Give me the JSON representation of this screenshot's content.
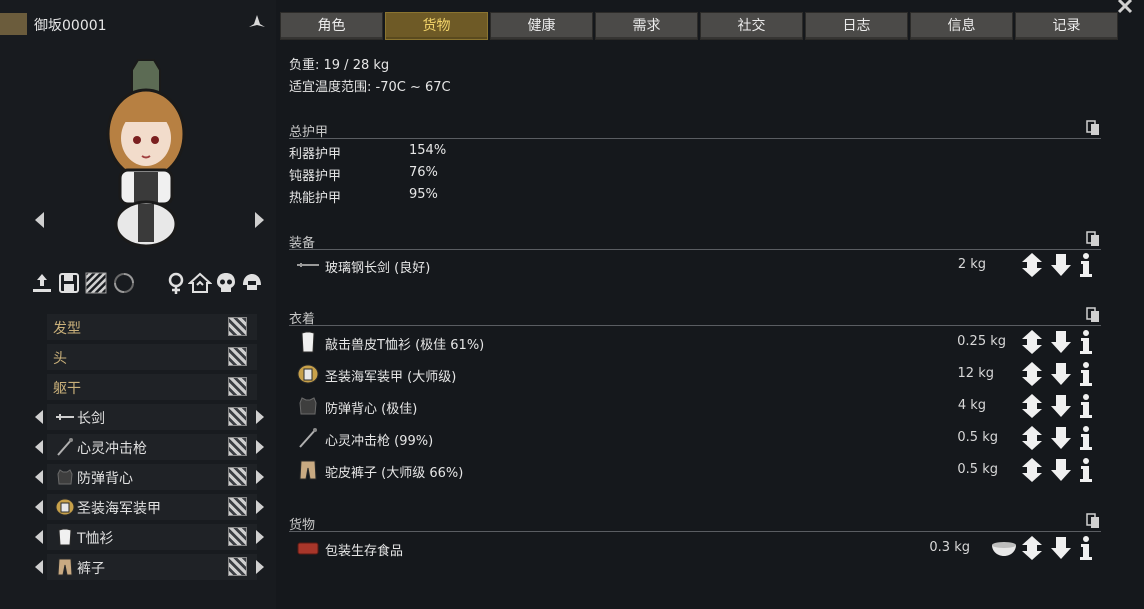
{
  "pawn": {
    "name": "御坂00001"
  },
  "tabs": [
    {
      "label": "角色"
    },
    {
      "label": "货物"
    },
    {
      "label": "健康"
    },
    {
      "label": "需求"
    },
    {
      "label": "社交"
    },
    {
      "label": "日志"
    },
    {
      "label": "信息"
    },
    {
      "label": "记录"
    }
  ],
  "active_tab_index": 1,
  "gear": {
    "mass_line": "负重: 19 / 28 kg",
    "temp_line": "适宜温度范围: -70C ~ 67C",
    "armor": {
      "title": "总护甲",
      "rows": [
        {
          "label": "利器护甲",
          "value": "154%"
        },
        {
          "label": "钝器护甲",
          "value": "76%"
        },
        {
          "label": "热能护甲",
          "value": "95%"
        }
      ]
    },
    "equipment": {
      "title": "装备",
      "items": [
        {
          "label": "玻璃钢长剑 (良好)",
          "mass": "2 kg",
          "icon": "longsword-icon"
        }
      ]
    },
    "apparel": {
      "title": "衣着",
      "items": [
        {
          "label": "敲击兽皮T恤衫 (极佳 61%)",
          "mass": "0.25 kg",
          "icon": "tshirt-icon"
        },
        {
          "label": "圣装海军装甲 (大师级)",
          "mass": "12 kg",
          "icon": "marine-armor-icon"
        },
        {
          "label": "防弹背心 (极佳)",
          "mass": "4 kg",
          "icon": "flak-vest-icon"
        },
        {
          "label": "心灵冲击枪 (99%)",
          "mass": "0.5 kg",
          "icon": "psychic-lance-icon"
        },
        {
          "label": "驼皮裤子 (大师级 66%)",
          "mass": "0.5 kg",
          "icon": "pants-icon"
        }
      ]
    },
    "inventory": {
      "title": "货物",
      "items": [
        {
          "label": "包装生存食品",
          "mass": "0.3 kg",
          "icon": "survival-meal-icon"
        }
      ]
    }
  },
  "slots": [
    {
      "label": "发型"
    },
    {
      "label": "头"
    },
    {
      "label": "躯干"
    },
    {
      "label": "长剑"
    },
    {
      "label": "心灵冲击枪"
    },
    {
      "label": "防弹背心"
    },
    {
      "label": "圣装海军装甲"
    },
    {
      "label": "T恤衫"
    },
    {
      "label": "裤子"
    }
  ],
  "colors": {
    "accent_gold": "#f2d46a",
    "tab_active": "#6e5a26",
    "tab": "#4b4a48",
    "background": "#15181c"
  }
}
